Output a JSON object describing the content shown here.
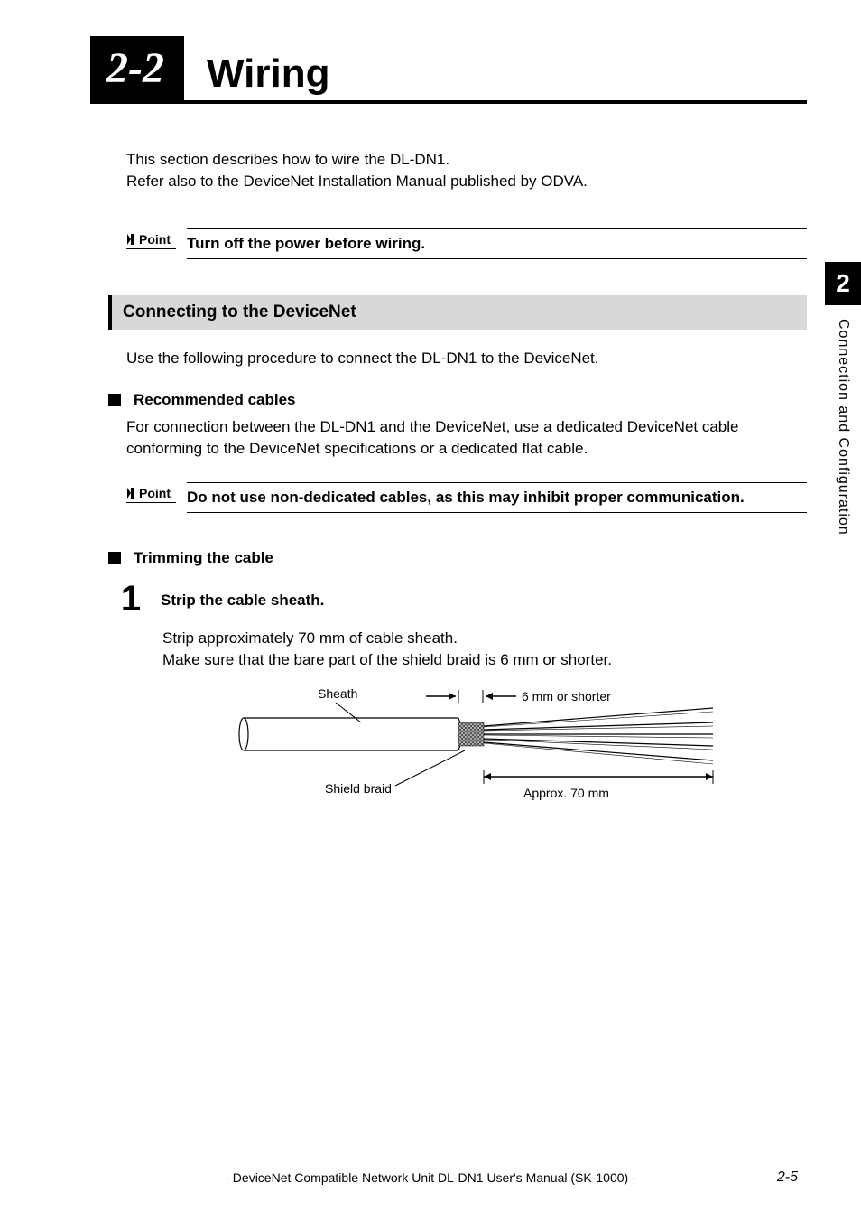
{
  "section": {
    "number": "2-2",
    "title": "Wiring"
  },
  "intro": {
    "line1": "This section describes how to wire the DL-DN1.",
    "line2": "Refer also to the DeviceNet Installation Manual published by ODVA."
  },
  "point1": {
    "label": "Point",
    "text": "Turn off the power before wiring."
  },
  "subsection": {
    "title": "Connecting to the DeviceNet",
    "intro": "Use the following procedure to connect the DL-DN1 to the DeviceNet."
  },
  "recommended": {
    "heading": "Recommended cables",
    "text": "For connection between the DL-DN1 and the DeviceNet, use a dedicated DeviceNet cable conforming to the DeviceNet specifications or a dedicated flat cable."
  },
  "point2": {
    "label": "Point",
    "text": "Do not use non-dedicated cables, as this may inhibit proper communication."
  },
  "trimming": {
    "heading": "Trimming the cable",
    "step1": {
      "number": "1",
      "title": "Strip the cable sheath.",
      "text1": "Strip approximately 70 mm of cable sheath.",
      "text2": "Make sure that the bare part of the shield braid is 6 mm or shorter."
    }
  },
  "diagram": {
    "sheath": "Sheath",
    "spec1": "6 mm or shorter",
    "shield": "Shield braid",
    "spec2": "Approx. 70 mm"
  },
  "sidetab": {
    "number": "2",
    "text": "Connection and Configuration"
  },
  "footer": {
    "text": "- DeviceNet Compatible Network Unit DL-DN1 User's Manual (SK-1000) -",
    "pagenum": "2-5"
  }
}
